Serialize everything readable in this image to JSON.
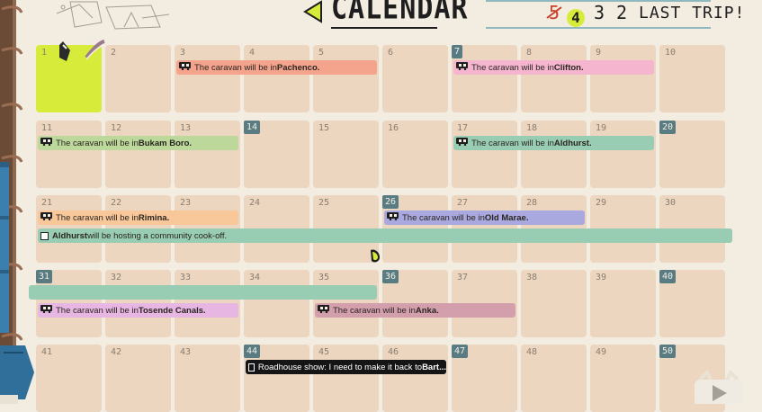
{
  "header": {
    "title": "CALENDAR",
    "trips_crossed": "5",
    "trips_current": "4",
    "trips_remaining": [
      "3",
      "2"
    ],
    "last_trip": "LAST TRIP!"
  },
  "days": [
    {
      "num": "1",
      "today": true
    },
    {
      "num": "2"
    },
    {
      "num": "3"
    },
    {
      "num": "4"
    },
    {
      "num": "5"
    },
    {
      "num": "6"
    },
    {
      "num": "7",
      "hl": true
    },
    {
      "num": "8"
    },
    {
      "num": "9"
    },
    {
      "num": "10"
    },
    {
      "num": "11"
    },
    {
      "num": "12"
    },
    {
      "num": "13"
    },
    {
      "num": "14",
      "hl": true
    },
    {
      "num": "15"
    },
    {
      "num": "16"
    },
    {
      "num": "17"
    },
    {
      "num": "18"
    },
    {
      "num": "19"
    },
    {
      "num": "20",
      "hl": true
    },
    {
      "num": "21"
    },
    {
      "num": "22"
    },
    {
      "num": "23"
    },
    {
      "num": "24"
    },
    {
      "num": "25"
    },
    {
      "num": "26",
      "hl": true
    },
    {
      "num": "27"
    },
    {
      "num": "28"
    },
    {
      "num": "29"
    },
    {
      "num": "30"
    },
    {
      "num": "31",
      "hl": true
    },
    {
      "num": "32"
    },
    {
      "num": "33"
    },
    {
      "num": "34"
    },
    {
      "num": "35"
    },
    {
      "num": "36",
      "hl": true
    },
    {
      "num": "37"
    },
    {
      "num": "38"
    },
    {
      "num": "39"
    },
    {
      "num": "40",
      "hl": true
    },
    {
      "num": "41"
    },
    {
      "num": "42"
    },
    {
      "num": "43"
    },
    {
      "num": "44",
      "hl": true
    },
    {
      "num": "45"
    },
    {
      "num": "46"
    },
    {
      "num": "47",
      "hl": true
    },
    {
      "num": "48"
    },
    {
      "num": "49"
    },
    {
      "num": "50",
      "hl": true
    }
  ],
  "events": [
    {
      "prefix": "The caravan will be in ",
      "place": "Pachenco.",
      "color": "#f4a38d",
      "icon": "caravan"
    },
    {
      "prefix": "The caravan will be in ",
      "place": "Clifton.",
      "color": "#f5b5cf",
      "icon": "caravan"
    },
    {
      "prefix": "The caravan will be in ",
      "place": "Bukam Boro.",
      "color": "#bdd89b",
      "icon": "caravan"
    },
    {
      "prefix": "The caravan will be in ",
      "place": "Aldhurst.",
      "color": "#98ccb3",
      "icon": "caravan"
    },
    {
      "prefix": "The caravan will be in ",
      "place": "Rimina.",
      "color": "#f8c79a",
      "icon": "caravan"
    },
    {
      "prefix": "The caravan will be in ",
      "place": "Old Marae.",
      "color": "#a9a8df",
      "icon": "caravan"
    },
    {
      "prefix": " will be hosting a community cook-off.",
      "place": "Aldhurst",
      "color": "#98ccb3",
      "icon": "checkbox",
      "place_first": true
    },
    {
      "prefix": "",
      "place": "",
      "color": "#98ccb3",
      "icon": "none"
    },
    {
      "prefix": "The caravan will be in ",
      "place": "Tosende Canals.",
      "color": "#e7b6e3",
      "icon": "caravan"
    },
    {
      "prefix": "The caravan will be in ",
      "place": "Anka.",
      "color": "#d49fad",
      "icon": "caravan"
    },
    {
      "prefix": "Roadhouse show: I need to make it back to ",
      "place": "Bart...",
      "color": "#151515",
      "icon": "checkbox",
      "dark": true
    }
  ]
}
